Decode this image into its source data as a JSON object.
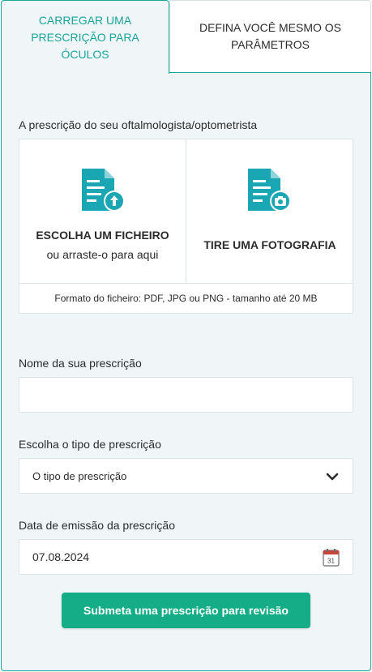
{
  "tabs": {
    "upload_label": "CARREGAR UMA PRESCRIÇÃO PARA ÓCULOS",
    "manual_label": "DEFINA VOCÊ MESMO OS PARÂMETROS"
  },
  "upload": {
    "section_label": "A prescrição do seu oftalmologista/optometrista",
    "file_title": "ESCOLHA UM FICHEIRO",
    "file_subtitle": "ou arraste-o para aqui",
    "photo_title": "TIRE UMA FOTOGRAFIA",
    "footer_note": "Formato do ficheiro: PDF, JPG ou PNG - tamanho até 20 MB"
  },
  "form": {
    "name_label": "Nome da sua prescrição",
    "name_value": "",
    "type_label": "Escolha o tipo de prescrição",
    "type_selected": "O tipo de prescrição",
    "date_label": "Data de emissão da prescrição",
    "date_value": "07.08.2024",
    "calendar_day": "31",
    "submit_label": "Submeta uma prescrição para revisão"
  },
  "colors": {
    "accent": "#17a79d",
    "submit": "#14ad88",
    "panel_bg": "#f0f6f7"
  },
  "icons": [
    "document-upload-icon",
    "document-camera-icon",
    "chevron-down-icon",
    "calendar-icon"
  ]
}
